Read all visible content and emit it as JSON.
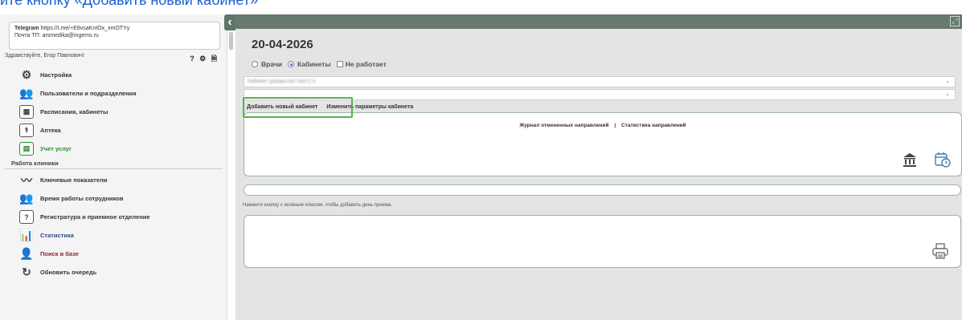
{
  "caption": "йте кнопку «Добавить новый кабинет»",
  "sidebar": {
    "telegram_label": "Telegram",
    "telegram_link": "https://t.me/+E8vsaKnIOx_xmOTYy",
    "tp_line": "Почта ТП: arsmedika@ingems.ru",
    "greeting": "Здравствуйте, Егор Павлович!",
    "status_icons": "? ⚙ 🗎",
    "items_top": [
      {
        "label": "Настройка",
        "icon": "gear-icon"
      },
      {
        "label": "Пользователи и подразделения",
        "icon": "users-icon"
      },
      {
        "label": "Расписания, кабинеты",
        "icon": "calendar-icon"
      },
      {
        "label": "Аптека",
        "icon": "pharmacy-icon"
      },
      {
        "label": "Учет услуг",
        "icon": "services-icon"
      }
    ],
    "section_title": "Работа клиники",
    "items_bottom": [
      {
        "label": "Ключевые показатели",
        "icon": "chart-line-icon"
      },
      {
        "label": "Время работы сотрудников",
        "icon": "staff-time-icon"
      },
      {
        "label": "Регистратура и приемное отделение",
        "icon": "registry-icon"
      },
      {
        "label": "Статистика",
        "icon": "statistics-icon"
      },
      {
        "label": "Поиск в базе",
        "icon": "search-user-icon"
      },
      {
        "label": "Обновить очередь",
        "icon": "refresh-icon"
      }
    ]
  },
  "main": {
    "date": "20-04-2026",
    "radios": [
      {
        "label": "Врачи",
        "checked": false
      },
      {
        "label": "Кабинеты",
        "checked": true
      }
    ],
    "checkbox_label": "Не работает",
    "select1_value": "Кабинет (размытый текст) 4",
    "select2_value": "",
    "tab_add": "Добавить новый кабинет",
    "tab_edit": "Изменить параметры кабинета",
    "link_journal": "Журнал отмененных направлений",
    "link_sep": "|",
    "link_stats": "Статистика направлений",
    "hint": "Нажмите кнопку с зелёным плюсом, чтобы добавить день приема."
  },
  "colors": {
    "topbar": "#667a70",
    "highlight": "#58b04f",
    "caption": "#1a5fd0"
  }
}
